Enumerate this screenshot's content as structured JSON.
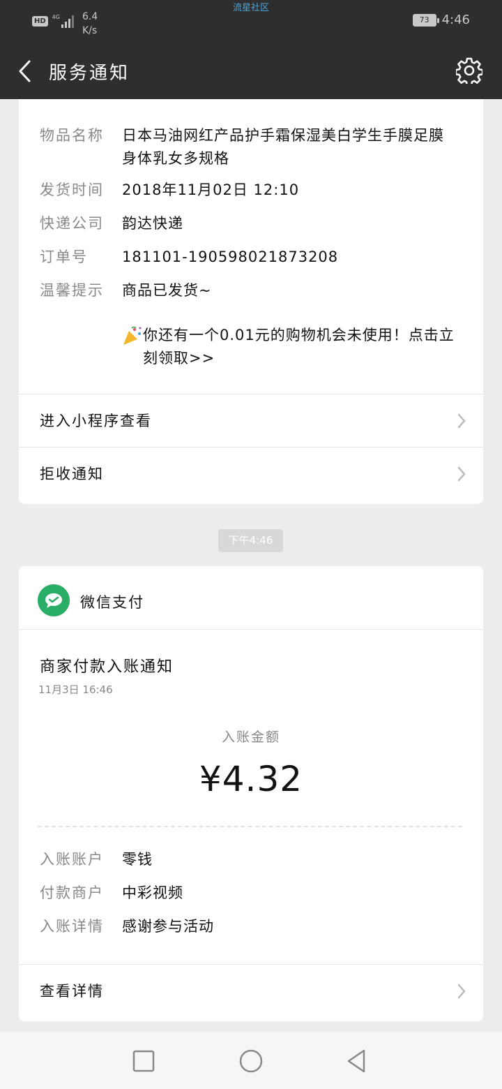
{
  "status_bar": {
    "hd_label": "HD",
    "network": "4G",
    "speed_value": "6.4",
    "speed_unit": "K/s",
    "watermark": "流星社区",
    "battery": "73",
    "time": "4:46"
  },
  "header": {
    "title": "服务通知",
    "back_icon": "chevron-left-icon",
    "settings_icon": "gear-icon"
  },
  "shipping_card": {
    "rows": [
      {
        "key": "物品名称",
        "value": "日本马油网红产品护手霜保湿美白学生手膜足膜身体乳女多规格"
      },
      {
        "key": "发货时间",
        "value": "2018年11月02日 12:10"
      },
      {
        "key": "快递公司",
        "value": "韵达快递"
      },
      {
        "key": "订单号",
        "value": "181101-190598021873208"
      },
      {
        "key": "温馨提示",
        "value": "商品已发货~"
      }
    ],
    "promo": "你还有一个0.01元的购物机会未使用！点击立刻领取>>",
    "actions": [
      {
        "label": "进入小程序查看"
      },
      {
        "label": "拒收通知"
      }
    ]
  },
  "time_chip": "下午4:46",
  "payment_card": {
    "app_name": "微信支付",
    "app_icon": "wechat-pay-icon",
    "title": "商家付款入账通知",
    "datetime": "11月3日  16:46",
    "amount_label": "入账金额",
    "amount": "¥4.32",
    "details": [
      {
        "key": "入账账户",
        "value": "零钱"
      },
      {
        "key": "付款商户",
        "value": "中彩视频"
      },
      {
        "key": "入账详情",
        "value": "感谢参与活动"
      }
    ],
    "action": {
      "label": "查看详情"
    }
  },
  "colors": {
    "header_bg": "#2e2e2e",
    "page_bg": "#ededed",
    "wechat_green": "#2aae67"
  }
}
